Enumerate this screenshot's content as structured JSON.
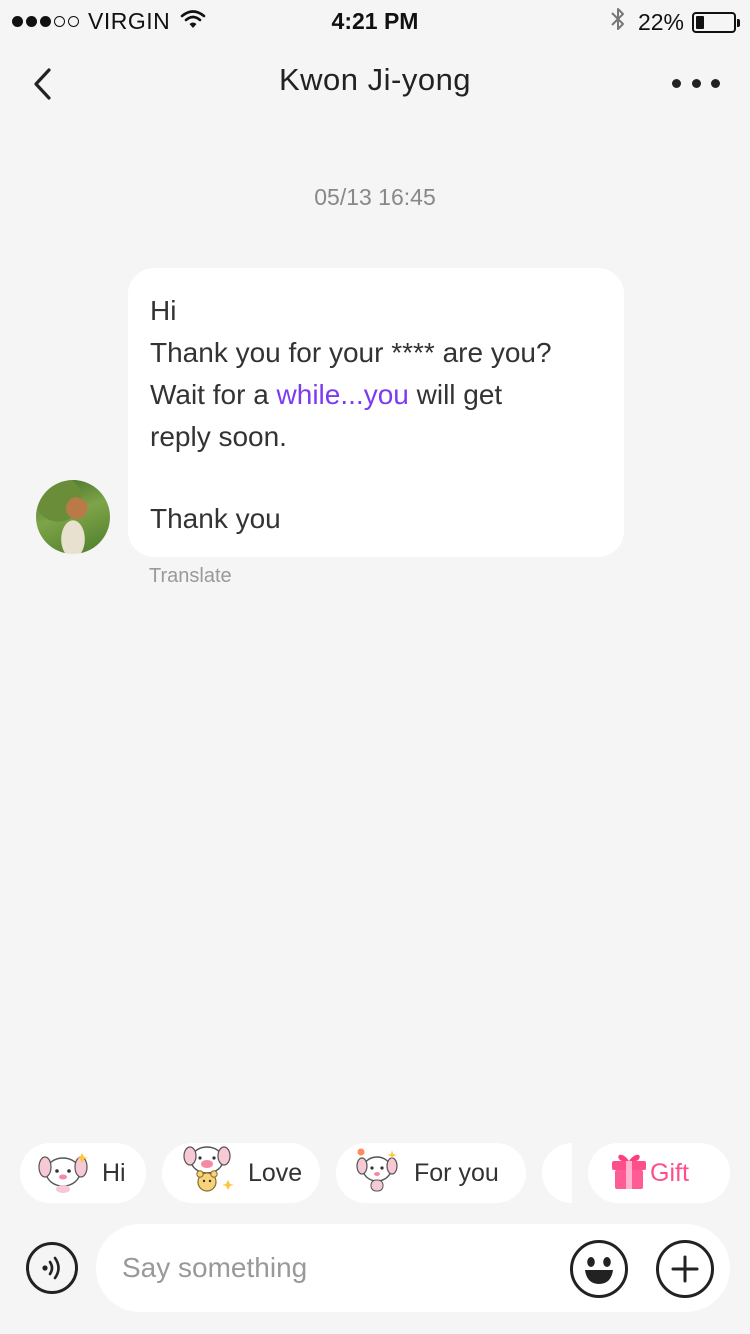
{
  "status_bar": {
    "signal_bars": [
      true,
      true,
      true,
      false,
      false
    ],
    "carrier": "VIRGIN",
    "time": "4:21 PM",
    "battery_percent_text": "22%",
    "battery_level": 0.22
  },
  "nav": {
    "title": "Kwon Ji-yong"
  },
  "chat": {
    "timestamp": "05/13 16:45",
    "message": {
      "line1": "Hi",
      "line2": "Thank you for your **** are you?",
      "line3_before": "Wait for a ",
      "line3_link": "while...you",
      "line3_after": " will get",
      "line4": "reply soon.",
      "line5": "Thank you"
    },
    "translate_label": "Translate"
  },
  "quick_replies": {
    "hi": "Hi",
    "love": "Love",
    "for_you": "For you",
    "gift": "Gift"
  },
  "input": {
    "placeholder": "Say something"
  },
  "icons": {
    "back": "chevron-left-icon",
    "more": "more-dots-icon",
    "voice": "voice-icon",
    "emoji": "emoji-icon",
    "plus": "plus-icon",
    "gift": "gift-icon",
    "wifi": "wifi-icon",
    "bluetooth": "bluetooth-icon",
    "battery": "battery-icon"
  },
  "colors": {
    "background": "#f5f5f5",
    "bubble": "#ffffff",
    "link": "#7b3cf0",
    "gift": "#ff4f8b"
  }
}
